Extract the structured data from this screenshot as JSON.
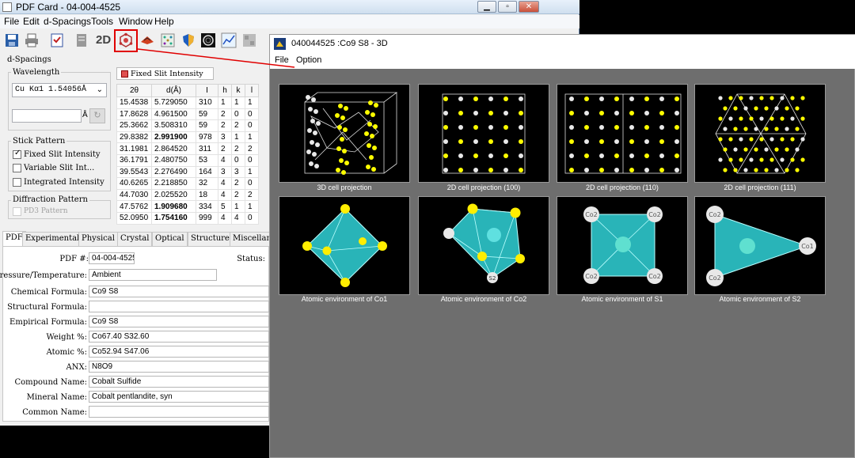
{
  "main_window": {
    "title": "PDF Card - 04-004-4525",
    "menu": [
      "File",
      "Edit",
      "d-Spacings",
      "Tools",
      "Window",
      "Help"
    ],
    "toolbar_2d": "2D"
  },
  "dspacings": {
    "group_title": "d-Spacings",
    "wavelength_label": "Wavelength",
    "wavelength_value": "Cu Kα1 1.54056Å",
    "angstrom_unit": "Å",
    "stick_pattern_label": "Stick Pattern",
    "options": [
      "Fixed Slit Intensity",
      "Variable Slit Int...",
      "Integrated Intensity"
    ],
    "checked": [
      true,
      false,
      false
    ],
    "diffraction_label": "Diffraction Pattern",
    "pd3_label": "PD3 Pattern"
  },
  "table": {
    "tab_label": "Fixed Slit Intensity",
    "headers": [
      "2θ",
      "d(Å)",
      "I",
      "h",
      "k",
      "l"
    ],
    "rows": [
      [
        "15.4538",
        "5.729050",
        "310",
        "1",
        "1",
        "1"
      ],
      [
        "17.8628",
        "4.961500",
        "59",
        "2",
        "0",
        "0"
      ],
      [
        "25.3662",
        "3.508310",
        "59",
        "2",
        "2",
        "0"
      ],
      [
        "29.8382",
        "2.991900",
        "978",
        "3",
        "1",
        "1"
      ],
      [
        "31.1981",
        "2.864520",
        "311",
        "2",
        "2",
        "2"
      ],
      [
        "36.1791",
        "2.480750",
        "53",
        "4",
        "0",
        "0"
      ],
      [
        "39.5543",
        "2.276490",
        "164",
        "3",
        "3",
        "1"
      ],
      [
        "40.6265",
        "2.218850",
        "32",
        "4",
        "2",
        "0"
      ],
      [
        "44.7030",
        "2.025520",
        "18",
        "4",
        "2",
        "2"
      ],
      [
        "47.5762",
        "1.909680",
        "334",
        "5",
        "1",
        "1"
      ],
      [
        "52.0950",
        "1.754160",
        "999",
        "4",
        "4",
        "0"
      ]
    ],
    "bold_rows": [
      3,
      9,
      10
    ]
  },
  "tabs": [
    "PDF",
    "Experimental",
    "Physical",
    "Crystal",
    "Optical",
    "Structure",
    "Miscellan"
  ],
  "form": {
    "pdf_label": "PDF #:",
    "pdf_value": "04-004-4525",
    "status_label": "Status:",
    "fields": [
      {
        "label": "Pressure/Temperature:",
        "value": "Ambient"
      },
      {
        "label": "Chemical Formula:",
        "value": "Co9 S8"
      },
      {
        "label": "Structural Formula:",
        "value": ""
      },
      {
        "label": "Empirical Formula:",
        "value": "Co9 S8"
      },
      {
        "label": "Weight %:",
        "value": "Co67.40 S32.60"
      },
      {
        "label": "Atomic %:",
        "value": "Co52.94 S47.06"
      },
      {
        "label": "ANX:",
        "value": "N8O9"
      },
      {
        "label": "Compound Name:",
        "value": "Cobalt Sulfide"
      },
      {
        "label": "Mineral Name:",
        "value": "Cobalt pentlandite, syn"
      },
      {
        "label": "Common Name:",
        "value": ""
      }
    ]
  },
  "window_3d": {
    "title": "040044525 :Co9 S8 -  3D",
    "menu": [
      "File",
      "Option"
    ],
    "captions": [
      "3D cell projection",
      "2D cell projection (100)",
      "2D cell projection (110)",
      "2D cell projection (111)",
      "Atomic environment of Co1",
      "Atomic environment of Co2",
      "Atomic environment of S1",
      "Atomic environment of S2"
    ],
    "atom_labels": {
      "co2": "Co2",
      "s2": "S2",
      "co1": "Co1"
    }
  },
  "colors": {
    "highlight": "#e00000",
    "cobalt": "#ffff00",
    "sulfur": "#e8e8e8",
    "polyhedron": "#2ec4c4"
  }
}
